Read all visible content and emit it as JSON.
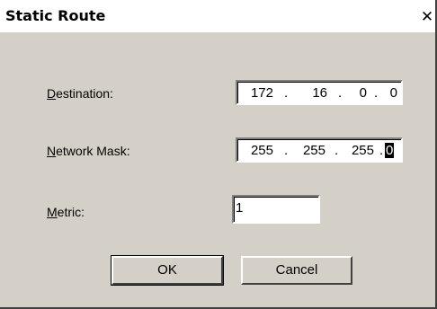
{
  "window": {
    "title": "Static Route",
    "close_glyph": "✕"
  },
  "fields": {
    "destination": {
      "label_accel": "D",
      "label_rest": "estination:",
      "octets": [
        "172",
        "16",
        "0",
        "0"
      ]
    },
    "network_mask": {
      "label_accel": "N",
      "label_rest": "etwork Mask:",
      "octets": [
        "255",
        "255",
        "255",
        "0"
      ]
    },
    "metric": {
      "label_accel": "M",
      "label_rest": "etric:",
      "value": "1"
    }
  },
  "separator": ".",
  "buttons": {
    "ok": "OK",
    "cancel": "Cancel"
  }
}
